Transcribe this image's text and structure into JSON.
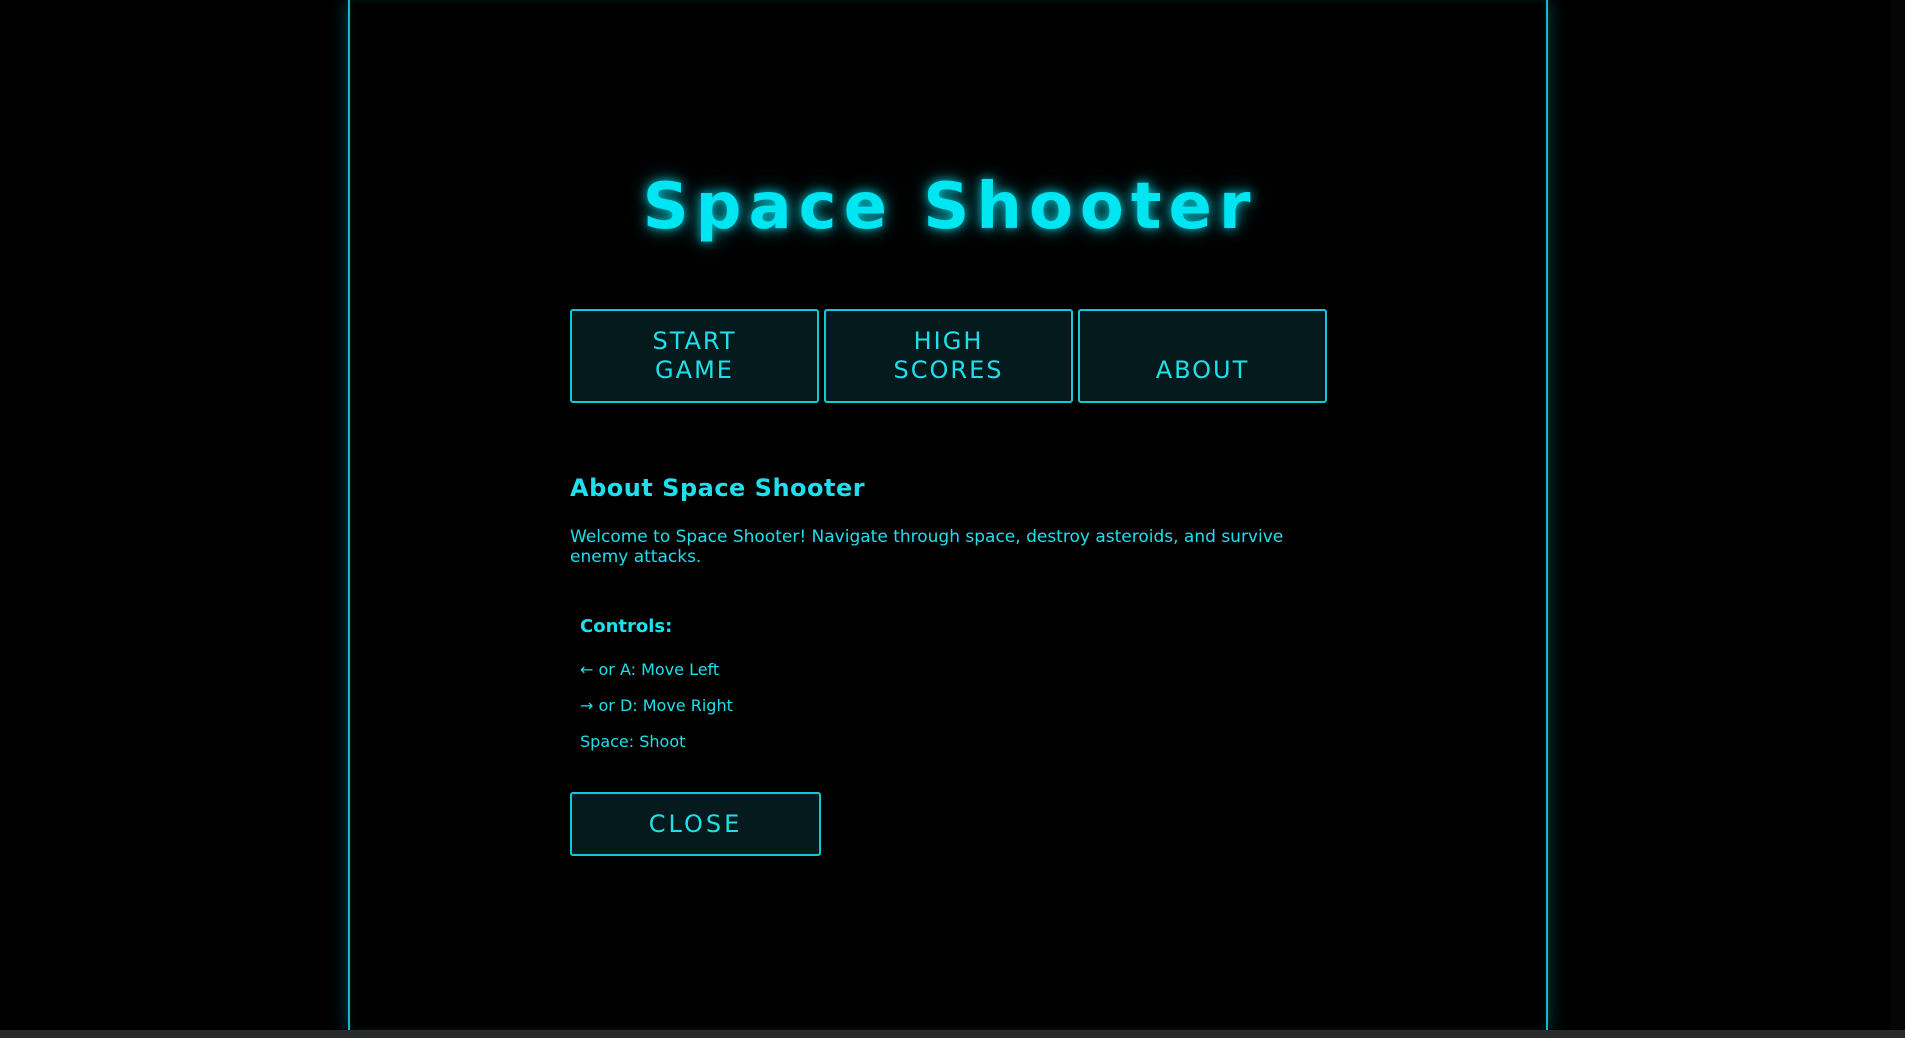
{
  "game": {
    "title": "Space Shooter"
  },
  "menu": {
    "start_line1": "START",
    "start_line2": "GAME",
    "high_line1": "HIGH",
    "high_line2": "SCORES",
    "about": "ABOUT"
  },
  "about_panel": {
    "heading": "About Space Shooter",
    "description": "Welcome to Space Shooter! Navigate through space, destroy asteroids, and survive enemy attacks.",
    "controls_title": "Controls:",
    "controls": [
      "← or A: Move Left",
      "→ or D: Move Right",
      "Space: Shoot"
    ],
    "close_label": "CLOSE"
  },
  "colors": {
    "accent": "#00e5f2",
    "border": "#14c9d6",
    "button_bg": "#041a1c",
    "background": "#000000"
  }
}
